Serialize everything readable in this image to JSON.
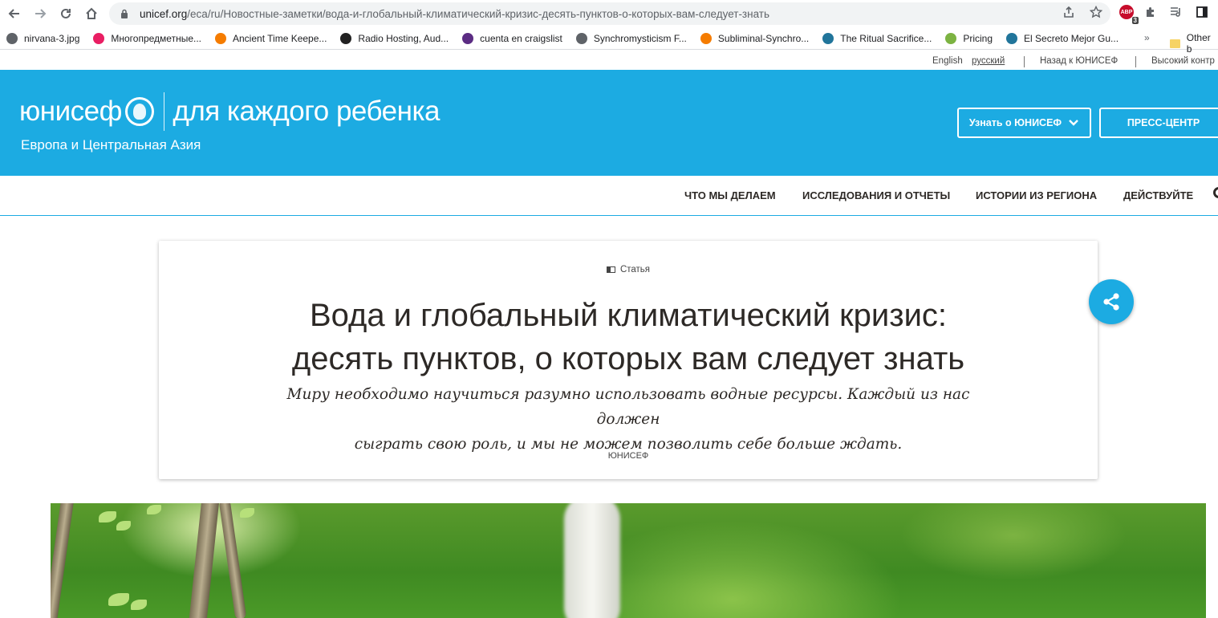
{
  "browser": {
    "url_domain": "unicef.org",
    "url_path": "/eca/ru/Новостные-заметки/вода-и-глобальный-климатический-кризис-десять-пунктов-о-которых-вам-следует-знать",
    "abp_label": "ABP",
    "abp_count": "3"
  },
  "bookmarks": {
    "items": [
      {
        "label": "nirvana-3.jpg",
        "color": "#5f6368"
      },
      {
        "label": "Многопредметные...",
        "color": "#e91e63"
      },
      {
        "label": "Ancient Time Keepe...",
        "color": "#f57c00"
      },
      {
        "label": "Radio Hosting, Aud...",
        "color": "#222222"
      },
      {
        "label": "cuenta en craigslist",
        "color": "#5b2c83"
      },
      {
        "label": "Synchromysticism F...",
        "color": "#5f6368"
      },
      {
        "label": "Subliminal-Synchro...",
        "color": "#f57c00"
      },
      {
        "label": "The Ritual Sacrifice...",
        "color": "#21759b"
      },
      {
        "label": "Pricing",
        "color": "#7cb342"
      },
      {
        "label": "El Secreto Mejor Gu...",
        "color": "#21759b"
      }
    ],
    "more": "»",
    "other": "Other b"
  },
  "utility": {
    "english": "English",
    "russian": "русский",
    "back": "Назад к ЮНИСЕФ",
    "contrast": "Высокий контр"
  },
  "header": {
    "brand": "юнисеф",
    "slogan": "для каждого ребенка",
    "region": "Европа и Центральная Азия",
    "learn_btn": "Узнать о ЮНИСЕФ",
    "press_btn": "ПРЕСС-ЦЕНТР",
    "accent": "#1cabe2"
  },
  "nav": {
    "items": [
      "ЧТО МЫ ДЕЛАЕМ",
      "ИССЛЕДОВАНИЯ И ОТЧЕТЫ",
      "ИСТОРИИ ИЗ РЕГИОНА",
      "ДЕЙСТВУЙТЕ"
    ]
  },
  "article": {
    "kind": "Статья",
    "title_line1": "Вода и глобальный климатический кризис:",
    "title_line2": "десять пунктов, о которых вам следует знать",
    "lead_line1": "Миру необходимо научиться разумно использовать водные ресурсы. Каждый из нас должен",
    "lead_line2": "сыграть свою роль, и мы не можем позволить себе больше ждать.",
    "author": "ЮНИСЕФ"
  }
}
